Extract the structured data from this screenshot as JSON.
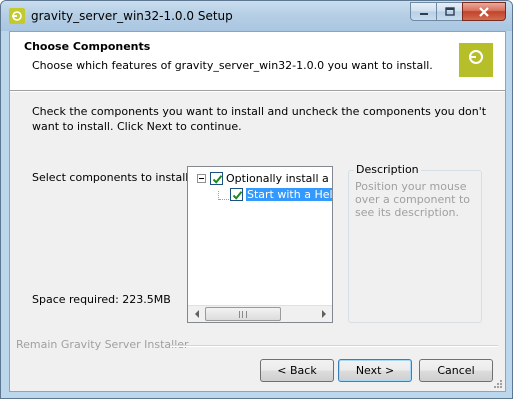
{
  "window": {
    "title": "gravity_server_win32-1.0.0 Setup"
  },
  "header": {
    "title": "Choose Components",
    "subtitle": "Choose which features of gravity_server_win32-1.0.0 you want to install."
  },
  "body": {
    "instructions": "Check the components you want to install and uncheck the components you don't want to install. Click Next to continue.",
    "select_label": "Select components to install:",
    "space_required": "Space required: 223.5MB"
  },
  "tree": {
    "items": [
      {
        "label": "Optionally install a wo",
        "checked": true,
        "expanded": true
      },
      {
        "label": "Start with a Helpo",
        "checked": true,
        "selected": true
      }
    ]
  },
  "description": {
    "legend": "Description",
    "text": "Position your mouse over a component to see its description."
  },
  "footer": {
    "brand": "Remain Gravity Server Installer"
  },
  "buttons": {
    "back": "< Back",
    "next": "Next >",
    "cancel": "Cancel"
  },
  "colors": {
    "accent_logo": "#b6bf2a",
    "selection": "#3399ff",
    "check": "#1f8a1f"
  }
}
